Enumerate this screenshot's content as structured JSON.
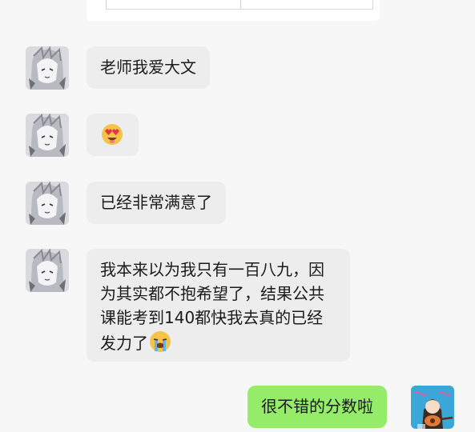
{
  "chat": {
    "messages": [
      {
        "sender": "other",
        "text": "老师我爱大文"
      },
      {
        "sender": "other",
        "emoji": "heart-eyes-icon"
      },
      {
        "sender": "other",
        "text": "已经非常满意了"
      },
      {
        "sender": "other",
        "lines": [
          "我本来以为我只有一百八九，因",
          "为其实都不抱希望了，结果公共",
          "课能考到140都快我去真的已经",
          "发力了"
        ],
        "trailing_emoji": "loudly-crying-icon"
      },
      {
        "sender": "me",
        "text": "很不错的分数啦"
      }
    ]
  },
  "colors": {
    "background": "#f7f7f8",
    "other_bubble": "#ededed",
    "my_bubble": "#95ec69"
  }
}
